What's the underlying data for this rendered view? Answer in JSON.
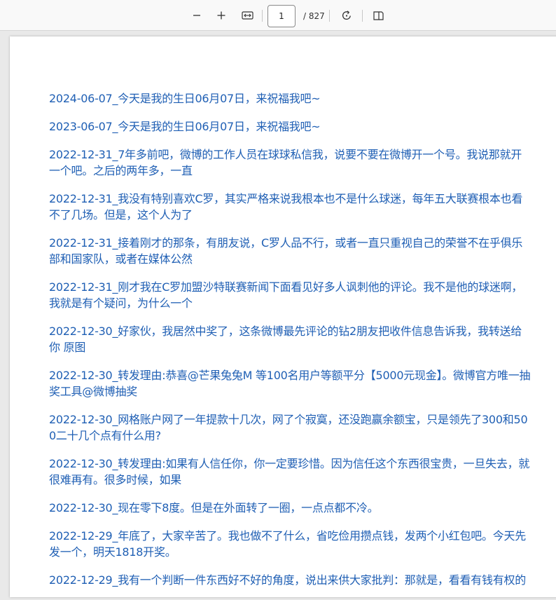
{
  "toolbar": {
    "zoom_out_icon": "minus-icon",
    "zoom_in_icon": "plus-icon",
    "fit_icon": "fit-width-icon",
    "current_page": "1",
    "total_pages": "/ 827",
    "rotate_icon": "rotate-icon",
    "two_page_icon": "page-view-icon"
  },
  "document": {
    "link_color": "#1f5fb4",
    "entries": [
      "2024-06-07_今天是我的生日06月07日，来祝福我吧~",
      "2023-06-07_今天是我的生日06月07日，来祝福我吧~",
      "2022-12-31_7年多前吧，微博的工作人员在球球私信我，说要不要在微博开一个号。我说那就开一个吧。之后的两年多，一直",
      "2022-12-31_我没有特别喜欢C罗，其实严格来说我根本也不是什么球迷，每年五大联赛根本也看不了几场。但是，这个人为了",
      "2022-12-31_接着刚才的那条，有朋友说，C罗人品不行，或者一直只重视自己的荣誉不在乎俱乐部和国家队，或者在媒体公然",
      "2022-12-31_刚才我在C罗加盟沙特联赛新闻下面看见好多人讽刺他的评论。我不是他的球迷啊，我就是有个疑问，为什么一个",
      "2022-12-30_好家伙，我居然中奖了，这条微博最先评论的钻2朋友把收件信息告诉我，我转送给你  原图",
      "2022-12-30_转发理由:恭喜@芒果兔兔M 等100名用户等额平分【5000元现金】。微博官方唯一抽奖工具@微博抽奖",
      "2022-12-30_网格账户网了一年提款十几次，网了个寂寞，还没跑赢余额宝，只是领先了300和500二十几个点有什么用?",
      "2022-12-30_转发理由:如果有人信任你，你一定要珍惜。因为信任这个东西很宝贵，一旦失去，就很难再有。很多时候，如果",
      "2022-12-30_现在零下8度。但是在外面转了一圈，一点点都不冷。",
      "2022-12-29_年底了，大家辛苦了。我也做不了什么，省吃俭用攒点钱，发两个小红包吧。今天先发一个，明天1818开奖。",
      "2022-12-29_我有一个判断一件东西好不好的角度，说出来供大家批判：那就是，看看有钱有权的"
    ]
  }
}
